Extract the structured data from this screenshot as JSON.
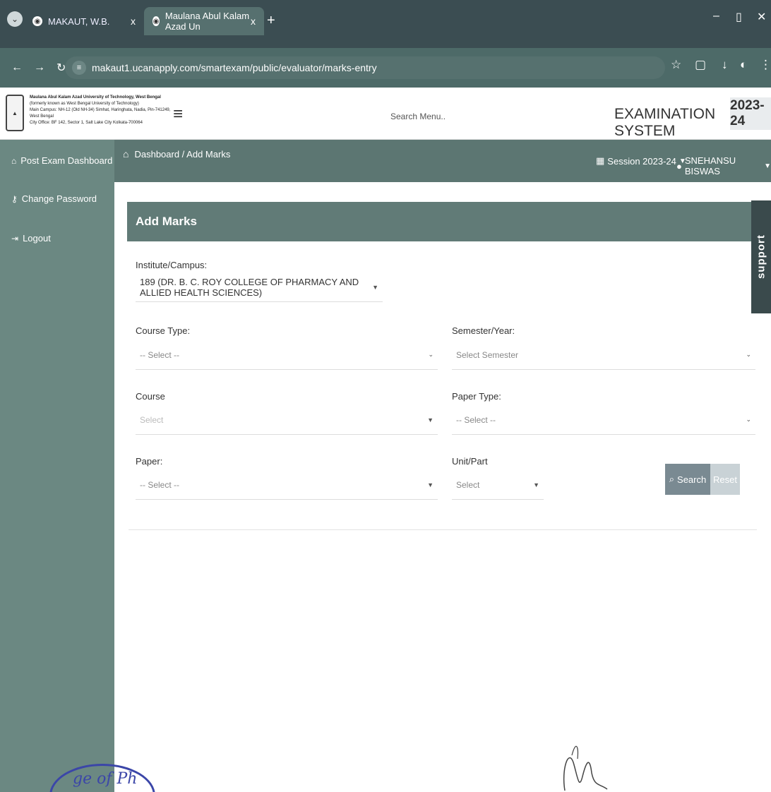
{
  "browser": {
    "tabs": [
      {
        "title": "MAKAUT, W.B.",
        "favicon": "globe-icon",
        "close": "x"
      },
      {
        "title": "Maulana Abul Kalam Azad Un",
        "favicon": "globe-icon",
        "close": "x"
      }
    ],
    "url": "makaut1.ucanapply.com/smartexam/public/evaluator/marks-entry"
  },
  "header": {
    "org_lines": [
      "Maulana Abul Kalam Azad University of Technology, West Bengal",
      "(formerly known as West Bengal University of Technology)",
      "Main Campus: NH-12 (Old NH-34) Simhat, Haringhata, Nadia, Pin-741249, West Bengal",
      "City Office: BF 142, Sector 1, Salt Lake City Kolkata-700064"
    ],
    "search_menu": "Search Menu..",
    "title": "EXAMINATION SYSTEM",
    "year": "2023-24"
  },
  "sidebar": {
    "items": [
      {
        "label": "Post Exam Dashboard",
        "icon": "home-icon"
      },
      {
        "label": "Change Password",
        "icon": "key-icon"
      },
      {
        "label": "Logout",
        "icon": "logout-icon"
      }
    ]
  },
  "topbar": {
    "breadcrumb": "Dashboard / Add Marks",
    "session": "Session 2023-24",
    "user": "SNEHANSU BISWAS"
  },
  "form": {
    "heading": "Add Marks",
    "institute_label": "Institute/Campus:",
    "institute_value": "189 (DR. B. C. ROY COLLEGE OF PHARMACY AND ALLIED HEALTH SCIENCES)",
    "course_type_label": "Course Type:",
    "course_type_value": "-- Select --",
    "semester_label": "Semester/Year:",
    "semester_value": "Select Semester",
    "course_label": "Course",
    "course_value": "Select",
    "paper_type_label": "Paper Type:",
    "paper_type_value": "-- Select --",
    "paper_label": "Paper:",
    "paper_value": "-- Select --",
    "unit_label": "Unit/Part",
    "unit_value": "Select",
    "search_button": "Search",
    "reset_button": "Reset"
  },
  "support_tab": "support",
  "seal_text": "ge of Ph"
}
